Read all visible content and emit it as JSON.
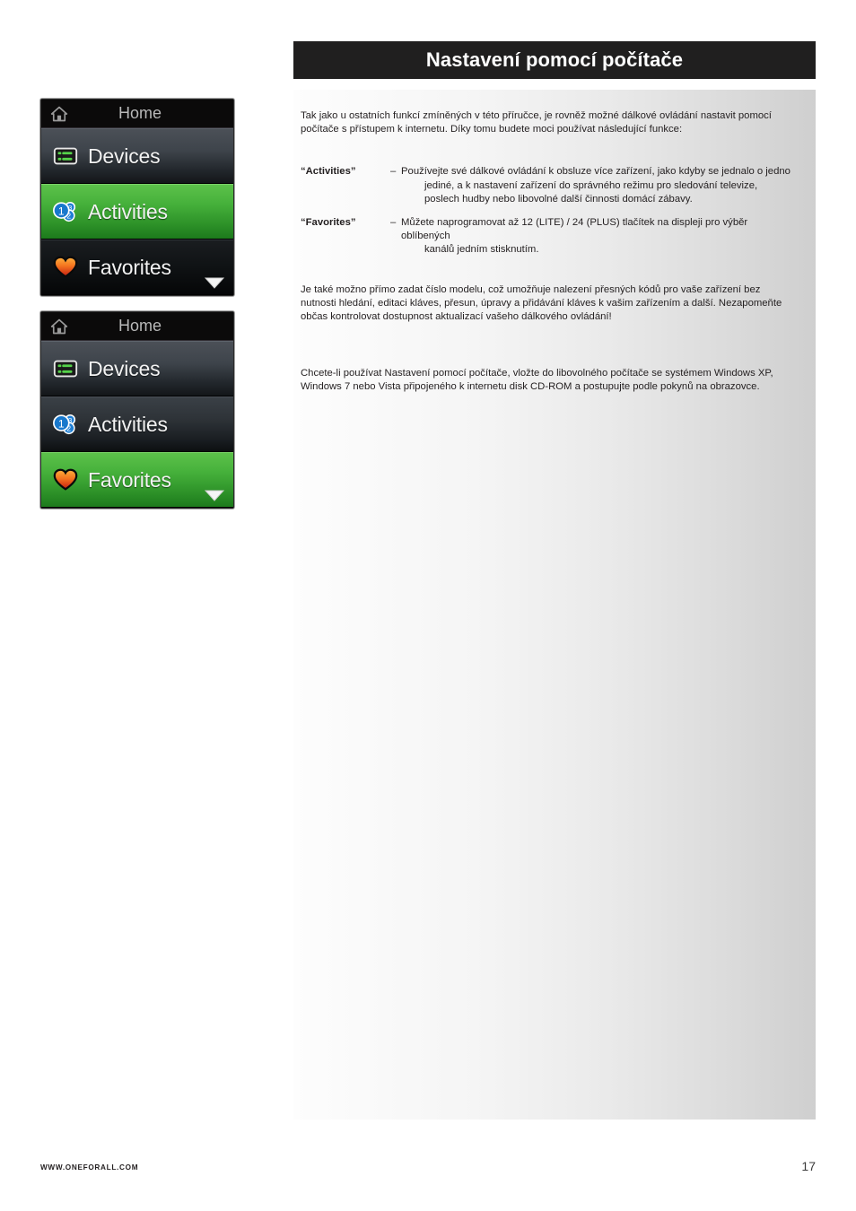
{
  "header": {
    "title": "Nastavení pomocí počítače"
  },
  "content": {
    "intro": "Tak jako u ostatních funkcí zmíněných v této příručce, je rovněž možné dálkové ovládání nastavit pomocí počítače s přístupem k internetu.  Díky tomu budete moci používat následující funkce:",
    "definitions": [
      {
        "term": "“Activities”",
        "dash": "–",
        "line1": "Používejte své dálkové ovládání k obsluze více zařízení, jako kdyby se jednalo o jedno",
        "line2": "jediné, a k nastavení zařízení do správného režimu pro sledování televize, poslech hudby nebo libovolné další činnosti domácí zábavy."
      },
      {
        "term": "“Favorites”",
        "dash": "–",
        "line1": "Můžete naprogramovat až 12 (LITE) / 24 (PLUS) tlačítek na displeji pro výběr oblíbených",
        "line2": "kanálů jedním stisknutím."
      }
    ],
    "paragraph_2": "Je také možno přímo zadat číslo modelu, což umožňuje nalezení přesných kódů pro vaše zařízení bez nutnosti hledání, editaci kláves, přesun, úpravy a přidávání kláves k vašim zařízením a další. Nezapomeňte občas kontrolovat dostupnost aktualizací vašeho dálkového ovládání!",
    "paragraph_3": "Chcete-li používat Nastavení pomocí počítače, vložte do libovolného počítače se systémem Windows XP, Windows 7 nebo Vista připojeného k internetu disk CD-ROM a postupujte podle pokynů na obrazovce."
  },
  "menus": [
    {
      "title": "Home",
      "title_icon": "home-icon",
      "rows": [
        {
          "label": "Devices",
          "icon": "devices-icon",
          "state": "normal"
        },
        {
          "label": "Activities",
          "icon": "activities-icon",
          "state": "selected"
        },
        {
          "label": "Favorites",
          "icon": "favorites-icon",
          "state": "dim"
        }
      ],
      "scroll_indicator": "chevron-down-icon"
    },
    {
      "title": "Home",
      "title_icon": "home-icon",
      "rows": [
        {
          "label": "Devices",
          "icon": "devices-icon",
          "state": "normal"
        },
        {
          "label": "Activities",
          "icon": "activities-icon",
          "state": "dim"
        },
        {
          "label": "Favorites",
          "icon": "favorites-icon",
          "state": "selected"
        }
      ],
      "scroll_indicator": "chevron-down-icon"
    }
  ],
  "footer": {
    "url": "WWW.ONEFORALL.COM",
    "page_number": "17"
  },
  "colors": {
    "header_bg": "#201f1f",
    "selected_green": "#46b13b",
    "row_dark": "#3e444b",
    "text": "#231f20"
  }
}
